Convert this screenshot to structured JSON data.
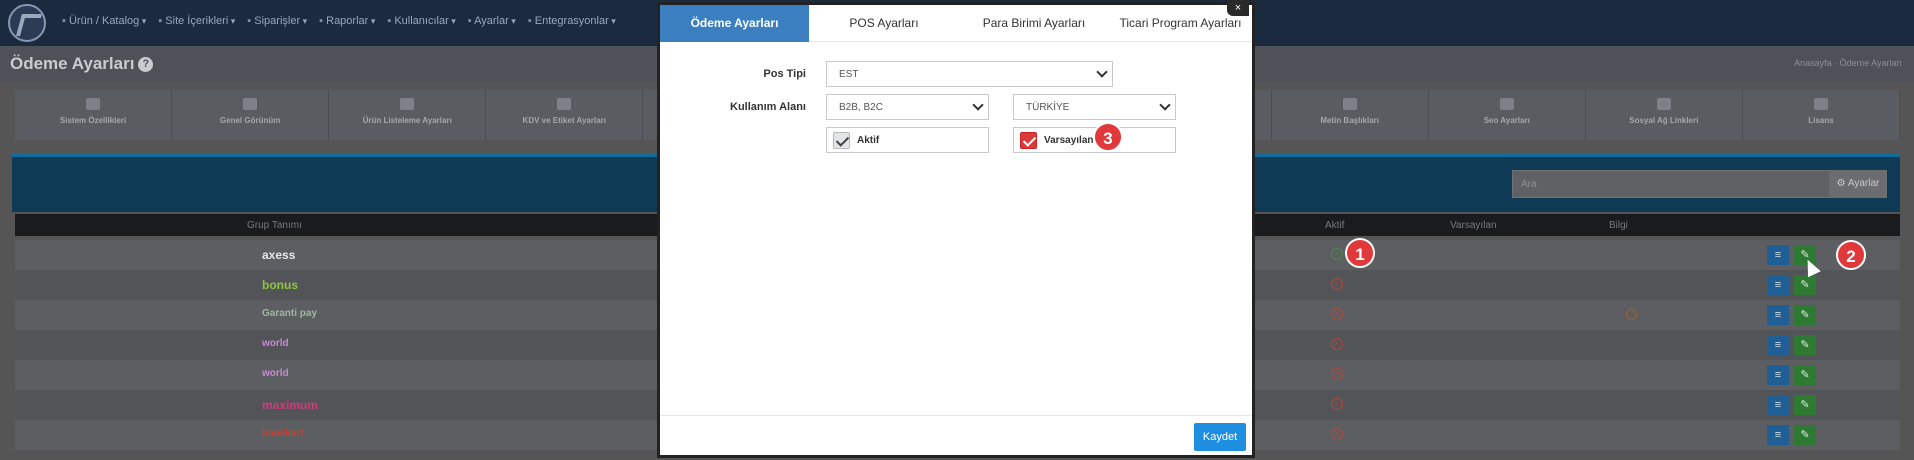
{
  "nav": {
    "items": [
      "Ürün / Katalog",
      "Site İçerikleri",
      "Siparişler",
      "Raporlar",
      "Kullanıcılar",
      "Ayarlar",
      "Entegrasyonlar"
    ]
  },
  "header": {
    "title": "Ödeme Ayarları",
    "help": "?",
    "breadcrumb": "Anasayfa · Ödeme Ayarları"
  },
  "tiles": [
    "Sistem Özellikleri",
    "Genel Görünüm",
    "Ürün Listeleme Ayarları",
    "KDV ve Etiket Ayarları",
    "",
    "",
    "",
    "",
    "Metin Başlıkları",
    "Seo Ayarları",
    "Sosyal Ağ Linkleri",
    "Lisans"
  ],
  "toolbar": {
    "search_placeholder": "Ara",
    "settings_label": "Ayarlar"
  },
  "table": {
    "headers": {
      "group": "Grup Tanımı",
      "active": "Aktif",
      "default": "Varsayılan",
      "info": "Bilgi"
    },
    "rows": [
      {
        "bank": "axess",
        "color": "#e8e8e8",
        "active": true
      },
      {
        "bank": "bonus",
        "color": "#8cc63f",
        "active": false
      },
      {
        "bank": "Garanti pay",
        "color": "#9fb7a0",
        "active": false,
        "info": true
      },
      {
        "bank": "world",
        "color": "#c58ad1",
        "active": false
      },
      {
        "bank": "world",
        "color": "#c58ad1",
        "active": false
      },
      {
        "bank": "maximum",
        "color": "#d4387f",
        "active": false
      },
      {
        "bank": "bankkart",
        "color": "#c8402f",
        "active": false
      }
    ]
  },
  "markers": [
    "1",
    "2",
    "3"
  ],
  "modal": {
    "close": "×",
    "tabs": [
      "Ödeme Ayarları",
      "POS Ayarları",
      "Para Birimi Ayarları",
      "Ticari Program Ayarları"
    ],
    "active_tab": 0,
    "pos_type_label": "Pos Tipi",
    "pos_type_value": "EST",
    "usage_label": "Kullanım Alanı",
    "usage_value": "B2B, B2C",
    "country_value": "TÜRKİYE",
    "active_label": "Aktif",
    "active_checked": true,
    "default_label": "Varsayılan",
    "default_checked": true,
    "save_label": "Kaydet"
  },
  "colors": {
    "primary": "#3c7fc1",
    "save": "#1e8ee0",
    "marker": "#e1393b"
  }
}
